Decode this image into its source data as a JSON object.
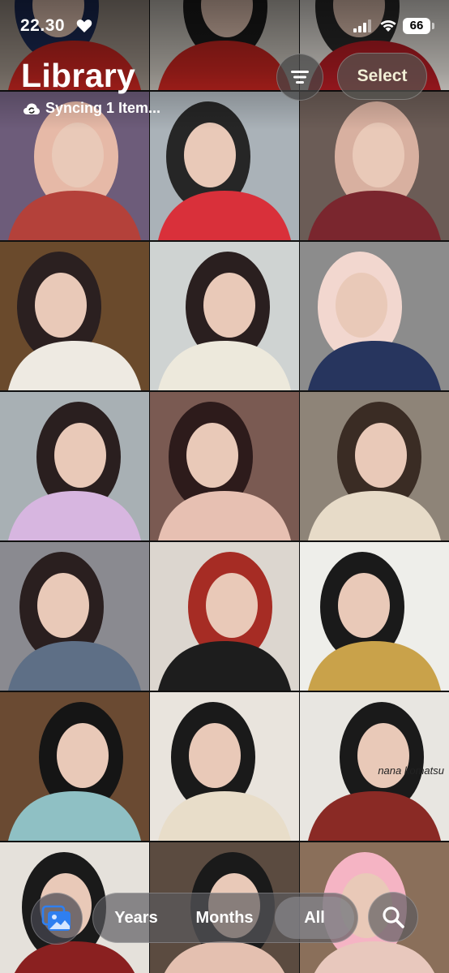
{
  "status_bar": {
    "time": "22.30",
    "battery": "66",
    "icons": [
      "heart-icon",
      "signal-icon",
      "wifi-icon",
      "battery-icon"
    ]
  },
  "header": {
    "title": "Library",
    "sync_status": "Syncing 1 Item...",
    "sync_icon": "cloud-sync-icon",
    "filter_icon": "filter-lines-icon",
    "select_label": "Select"
  },
  "photos": [
    {
      "tones": [
        "#9a8f85",
        "#c0241f",
        "#1b2a55"
      ]
    },
    {
      "tones": [
        "#c7c2ba",
        "#c0241f",
        "#1b1b1b"
      ]
    },
    {
      "tones": [
        "#e6e2dc",
        "#b81c24",
        "#2a2a2a"
      ]
    },
    {
      "tones": [
        "#6d5c7a",
        "#b4413a",
        "#e6b9a7"
      ]
    },
    {
      "tones": [
        "#aab2b8",
        "#d9303a",
        "#262626"
      ]
    },
    {
      "tones": [
        "#6b5c56",
        "#7a262e",
        "#d8b0a0"
      ]
    },
    {
      "tones": [
        "#6a4a2c",
        "#eeeae2",
        "#2b2020"
      ]
    },
    {
      "tones": [
        "#cfd3d2",
        "#ede9dc",
        "#2a1f1f"
      ]
    },
    {
      "tones": [
        "#8c8c8c",
        "#27355e",
        "#f2d7cf"
      ]
    },
    {
      "tones": [
        "#a8b0b4",
        "#d7b6e0",
        "#2a1f1f"
      ]
    },
    {
      "tones": [
        "#7a5a52",
        "#e7c0b2",
        "#2d1b1b"
      ]
    },
    {
      "tones": [
        "#8e8478",
        "#e7dbc8",
        "#3a2c24"
      ]
    },
    {
      "tones": [
        "#8a8a90",
        "#5e6f86",
        "#2a1f1f"
      ]
    },
    {
      "tones": [
        "#dcd6cf",
        "#1d1d1d",
        "#a62c24"
      ]
    },
    {
      "tones": [
        "#eeeeea",
        "#c9a24a",
        "#1a1a1a"
      ]
    },
    {
      "tones": [
        "#6a4a32",
        "#8fc0c4",
        "#151515"
      ]
    },
    {
      "tones": [
        "#e9e4dd",
        "#e8ddc9",
        "#1a1a1a"
      ]
    },
    {
      "tones": [
        "#e8e6e1",
        "#8a2a25",
        "#1a1a1a"
      ],
      "caption": "nana komatsu"
    },
    {
      "tones": [
        "#e5e1db",
        "#8a2020",
        "#1a1a1a"
      ]
    },
    {
      "tones": [
        "#5b4b40",
        "#e4c0b0",
        "#1a1a1a"
      ]
    },
    {
      "tones": [
        "#8a6f5a",
        "#e8c8bd",
        "#f5b4c4"
      ]
    }
  ],
  "toolbar": {
    "library_icon": "photo-library-icon",
    "segments": [
      "Years",
      "Months",
      "All"
    ],
    "selected_segment": "All",
    "search_icon": "search-icon"
  }
}
